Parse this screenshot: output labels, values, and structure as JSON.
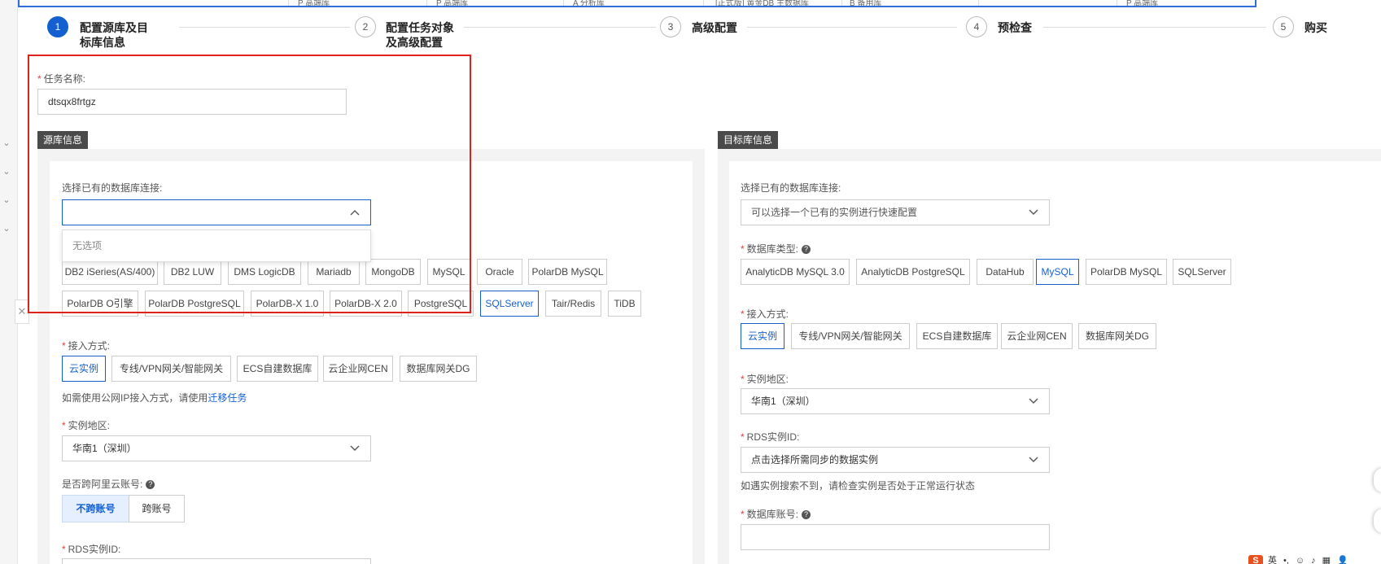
{
  "top_table": {
    "cells": [
      "P 高端库",
      "P 高端库",
      "A 分析库",
      "[正式版] 黄金DB 主数据库",
      "B 备用库",
      "P 高端库"
    ]
  },
  "steps": [
    {
      "num": "1",
      "label_line1": "配置源库及目",
      "label_line2": "标库信息",
      "active": true
    },
    {
      "num": "2",
      "label_line1": "配置任务对象",
      "label_line2": "及高级配置",
      "active": false
    },
    {
      "num": "3",
      "label_line1": "高级配置",
      "label_line2": "",
      "active": false
    },
    {
      "num": "4",
      "label_line1": "预检查",
      "label_line2": "",
      "active": false
    },
    {
      "num": "5",
      "label_line1": "购买",
      "label_line2": "",
      "active": false
    }
  ],
  "task": {
    "name_label": "任务名称:",
    "name_value": "dtsqx8frtgz"
  },
  "source": {
    "section_title": "源库信息",
    "conn_label": "选择已有的数据库连接:",
    "conn_value": "",
    "dropdown_empty": "无选项",
    "db_types_row1": [
      "DB2 iSeries(AS/400)",
      "DB2 LUW",
      "DMS LogicDB",
      "Mariadb",
      "MongoDB",
      "MySQL",
      "Oracle",
      "PolarDB MySQL"
    ],
    "db_types_row2": [
      "PolarDB O引擎",
      "PolarDB PostgreSQL",
      "PolarDB-X 1.0",
      "PolarDB-X 2.0",
      "PostgreSQL",
      "SQLServer",
      "Tair/Redis",
      "TiDB"
    ],
    "selected_db_type": "SQLServer",
    "access_label": "接入方式:",
    "access_methods": [
      "云实例",
      "专线/VPN网关/智能网关",
      "ECS自建数据库",
      "云企业网CEN",
      "数据库网关DG"
    ],
    "selected_access": "云实例",
    "access_hint_prefix": "如需使用公网IP接入方式，请使用",
    "access_hint_link": "迁移任务",
    "region_label": "实例地区:",
    "region_value": "华南1（深圳）",
    "cross_account_label": "是否跨阿里云账号:",
    "cross_account_options": [
      "不跨账号",
      "跨账号"
    ],
    "cross_account_selected": "不跨账号",
    "rds_label": "RDS实例ID:"
  },
  "target": {
    "section_title": "目标库信息",
    "conn_label": "选择已有的数据库连接:",
    "conn_placeholder": "可以选择一个已有的实例进行快速配置",
    "db_type_label": "数据库类型:",
    "db_types": [
      "AnalyticDB MySQL 3.0",
      "AnalyticDB PostgreSQL",
      "DataHub",
      "MySQL",
      "PolarDB MySQL",
      "SQLServer"
    ],
    "selected_db_type": "MySQL",
    "access_label": "接入方式:",
    "access_methods": [
      "云实例",
      "专线/VPN网关/智能网关",
      "ECS自建数据库",
      "云企业网CEN",
      "数据库网关DG"
    ],
    "selected_access": "云实例",
    "region_label": "实例地区:",
    "region_value": "华南1（深圳）",
    "rds_label": "RDS实例ID:",
    "rds_placeholder": "点击选择所需同步的数据实例",
    "rds_hint": "如遇实例搜索不到，请检查实例是否处于正常运行状态",
    "account_label": "数据库账号:",
    "account_value": ""
  },
  "ime": {
    "lang": "英",
    "logo": "S"
  },
  "colors": {
    "primary": "#1460d1",
    "annotation": "#e0201a",
    "section_tag": "#4a4a4a"
  }
}
